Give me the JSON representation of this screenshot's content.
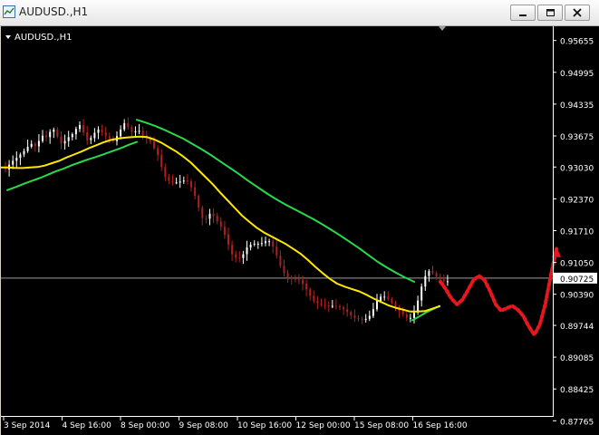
{
  "window": {
    "title": "AUDUSD.,H1",
    "icon": "chart-window-icon"
  },
  "title_buttons": [
    "minimize-icon",
    "restore-icon",
    "close-icon"
  ],
  "chart_data": {
    "type": "candlestick",
    "label": "AUDUSD.,H1",
    "price_ticks": [
      "0.95655",
      "0.94995",
      "0.94335",
      "0.93675",
      "0.93030",
      "0.92370",
      "0.91710",
      "0.91050",
      "0.90390",
      "0.89744",
      "0.89085",
      "0.88425",
      "0.87765"
    ],
    "current_price": "0.90725",
    "time_ticks": [
      "3 Sep 2014",
      "4 Sep 16:00",
      "8 Sep 00:00",
      "9 Sep 08:00",
      "10 Sep 16:00",
      "12 Sep 00:00",
      "15 Sep 08:00",
      "16 Sep 16:00"
    ],
    "ylim": [
      0.8747,
      0.9595
    ],
    "closes": [
      0.9298,
      0.9308,
      0.9316,
      0.9322,
      0.9329,
      0.9336,
      0.9345,
      0.9351,
      0.9346,
      0.9357,
      0.9368,
      0.9365,
      0.9376,
      0.9381,
      0.9366,
      0.9352,
      0.9357,
      0.9365,
      0.9371,
      0.9382,
      0.939,
      0.9375,
      0.9359,
      0.9363,
      0.9374,
      0.9381,
      0.9375,
      0.9367,
      0.9362,
      0.9357,
      0.9367,
      0.9381,
      0.9394,
      0.9386,
      0.9376,
      0.9377,
      0.9378,
      0.9368,
      0.9362,
      0.9356,
      0.9342,
      0.9328,
      0.9303,
      0.9283,
      0.9274,
      0.9271,
      0.9271,
      0.9273,
      0.9275,
      0.9273,
      0.9261,
      0.9243,
      0.9219,
      0.9197,
      0.9196,
      0.9206,
      0.9202,
      0.919,
      0.9179,
      0.9163,
      0.9142,
      0.9122,
      0.9115,
      0.9114,
      0.9122,
      0.9136,
      0.9142,
      0.9144,
      0.9144,
      0.9145,
      0.9149,
      0.9149,
      0.9138,
      0.9119,
      0.9098,
      0.9083,
      0.9074,
      0.9072,
      0.907,
      0.9068,
      0.9061,
      0.9049,
      0.9036,
      0.9025,
      0.902,
      0.9017,
      0.9016,
      0.9015,
      0.9015,
      0.9014,
      0.9012,
      0.9008,
      0.9002,
      0.8995,
      0.899,
      0.8988,
      0.8987,
      0.8988,
      0.8994,
      0.9008,
      0.9025,
      0.9034,
      0.9034,
      0.9029,
      0.9021,
      0.9013,
      0.9005,
      0.8997,
      0.899,
      0.899,
      0.9001,
      0.9026,
      0.9055,
      0.9077,
      0.9087,
      0.9083,
      0.9076,
      0.907,
      0.9066,
      0.9066
    ],
    "ma_yellow": [
      0.9302,
      0.9302,
      0.9301,
      0.9301,
      0.9302,
      0.9303,
      0.9306,
      0.9311,
      0.9316,
      0.9323,
      0.9329,
      0.9335,
      0.9342,
      0.9348,
      0.9354,
      0.9359,
      0.9362,
      0.9364,
      0.9365,
      0.9366,
      0.9365,
      0.936,
      0.9353,
      0.9344,
      0.9335,
      0.9324,
      0.9312,
      0.9297,
      0.9282,
      0.9267,
      0.925,
      0.9234,
      0.9218,
      0.9202,
      0.9189,
      0.9177,
      0.9167,
      0.9159,
      0.9151,
      0.9143,
      0.9133,
      0.9123,
      0.911,
      0.9096,
      0.9083,
      0.9071,
      0.9061,
      0.9055,
      0.905,
      0.9045,
      0.9038,
      0.903,
      0.9023,
      0.9016,
      0.9011,
      0.9007,
      0.9003,
      0.9003,
      0.9004,
      0.9009,
      0.9014
    ],
    "ma_green_upper": [
      0.9401,
      0.9395,
      0.9388,
      0.938,
      0.9371,
      0.9362,
      0.9351,
      0.934,
      0.9328,
      0.9315,
      0.9302,
      0.9289,
      0.9275,
      0.9262,
      0.9249,
      0.9237,
      0.9226,
      0.9216,
      0.9206,
      0.9196,
      0.9185,
      0.9173,
      0.9161,
      0.9148,
      0.9135,
      0.9121,
      0.9107,
      0.9095,
      0.9084,
      0.9074,
      0.9065
    ],
    "ma_green_lower": [
      0.9255,
      0.9261,
      0.9268,
      0.9274,
      0.928,
      0.9287,
      0.9294,
      0.93,
      0.9307,
      0.9313,
      0.9319,
      0.9324,
      0.933,
      0.9336,
      0.9342,
      0.9349,
      0.9355
    ],
    "ma_green_short": [
      0.8985,
      0.8993,
      0.9001,
      0.9008,
      0.9015
    ],
    "forecast": [
      0.9065,
      0.9049,
      0.903,
      0.9018,
      0.9028,
      0.9048,
      0.9069,
      0.9077,
      0.9068,
      0.9045,
      0.9018,
      0.9005,
      0.901,
      0.9015,
      0.9007,
      0.8994,
      0.8972,
      0.8955,
      0.8976,
      0.9019,
      0.9079,
      0.9133
    ],
    "grid": false,
    "colors": {
      "bg": "#000000",
      "bull": "#ffffff",
      "bear": "#b11f1f",
      "ma": "#ffe800",
      "envelope": "#29d949",
      "forecast": "#e8171e",
      "axis": "#ffffff",
      "price_line": "#9e9e9e"
    }
  }
}
